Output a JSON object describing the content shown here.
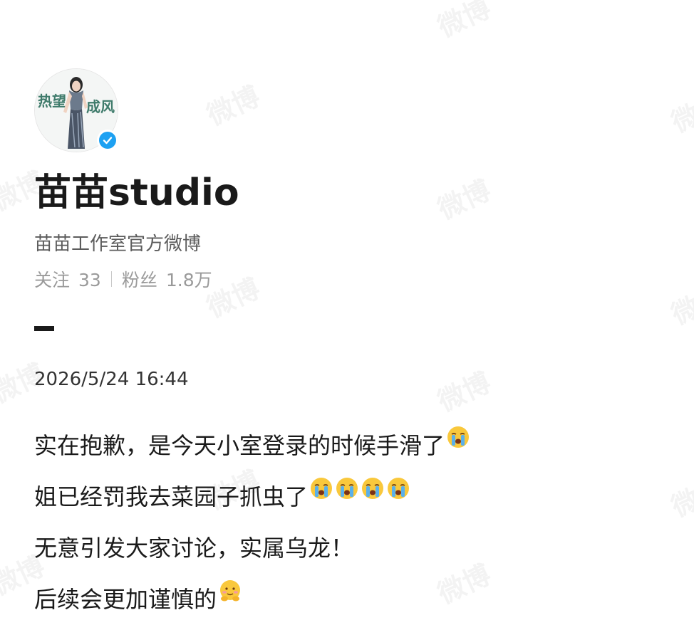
{
  "watermark": {
    "text": "微博"
  },
  "profile": {
    "avatar_label": "profile-photo",
    "avatar_lettering_left": "热望",
    "avatar_lettering_right": "成风",
    "verified_icon": "verified-check-icon",
    "verified_color": "#1da1f2",
    "name": "苗苗studio",
    "bio": "苗苗工作室官方微博",
    "following_label": "关注",
    "following_count": "33",
    "followers_label": "粉丝",
    "followers_count": "1.8万"
  },
  "post": {
    "timestamp": "2026/5/24 16:44",
    "lines": [
      {
        "text": "实在抱歉，是今天小室登录的时候手滑了",
        "emoji": [
          "crying-emoji"
        ]
      },
      {
        "text": "姐已经罚我去菜园子抓虫了",
        "emoji": [
          "crying-emoji",
          "crying-emoji",
          "crying-emoji",
          "crying-emoji"
        ]
      },
      {
        "text": "无意引发大家讨论，实属乌龙！",
        "emoji": []
      },
      {
        "text": "后续会更加谨慎的",
        "emoji": [
          "shy-emoji"
        ]
      }
    ]
  }
}
